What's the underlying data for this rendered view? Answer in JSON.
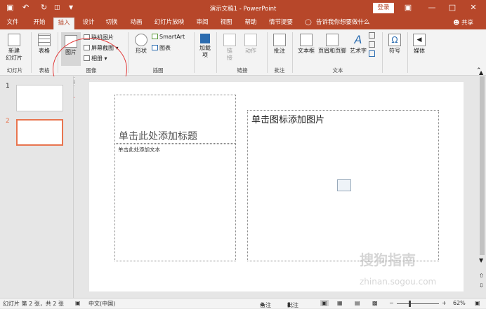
{
  "window": {
    "title": "演示文稿1 - PowerPoint",
    "login_label": "登录"
  },
  "tabs": [
    {
      "label": "文件"
    },
    {
      "label": "开始"
    },
    {
      "label": "插入"
    },
    {
      "label": "设计"
    },
    {
      "label": "切换"
    },
    {
      "label": "动画"
    },
    {
      "label": "幻灯片放映"
    },
    {
      "label": "审阅"
    },
    {
      "label": "视图"
    },
    {
      "label": "帮助"
    },
    {
      "label": "情节提要"
    }
  ],
  "active_tab": "插入",
  "tell_me": "告诉我你想要做什么",
  "share_label": "共享",
  "ribbon": {
    "new_slide": "新建\n幻灯片",
    "table": "表格",
    "picture": "图片",
    "online_pictures": "联机图片",
    "screenshot": "屏幕截图",
    "album": "相册",
    "shapes": "形状",
    "smartart": "SmartArt",
    "chart": "图表",
    "addins": "加载\n项",
    "link": "链\n接",
    "action": "动作",
    "comment": "批注",
    "textbox": "文本框",
    "header_footer": "页眉和页脚",
    "wordart": "艺术字",
    "symbol": "符号",
    "media": "媒体",
    "groups": {
      "slides": "幻灯片",
      "tables": "表格",
      "images": "图像",
      "illustrations": "插图",
      "links": "链接",
      "comments": "批注",
      "text": "文本"
    }
  },
  "tooltip": "图片",
  "slides": [
    {
      "number": "1"
    },
    {
      "number": "2"
    }
  ],
  "slide": {
    "title_placeholder": "单击此处添加标题",
    "text_placeholder": "单击此处添加文本",
    "picture_placeholder": "单击图标添加图片"
  },
  "status": {
    "slide_info": "幻灯片 第 2 张，共 2 张",
    "language": "中文(中国)",
    "notes": "备注",
    "comments": "批注",
    "zoom": "62%"
  },
  "watermark": {
    "text": "搜狗指南",
    "url": "zhinan.sogou.com"
  },
  "colors": {
    "accent": "#b7472a",
    "selected_thumb": "#e8754f",
    "annotation_circle": "#e23a3a"
  }
}
